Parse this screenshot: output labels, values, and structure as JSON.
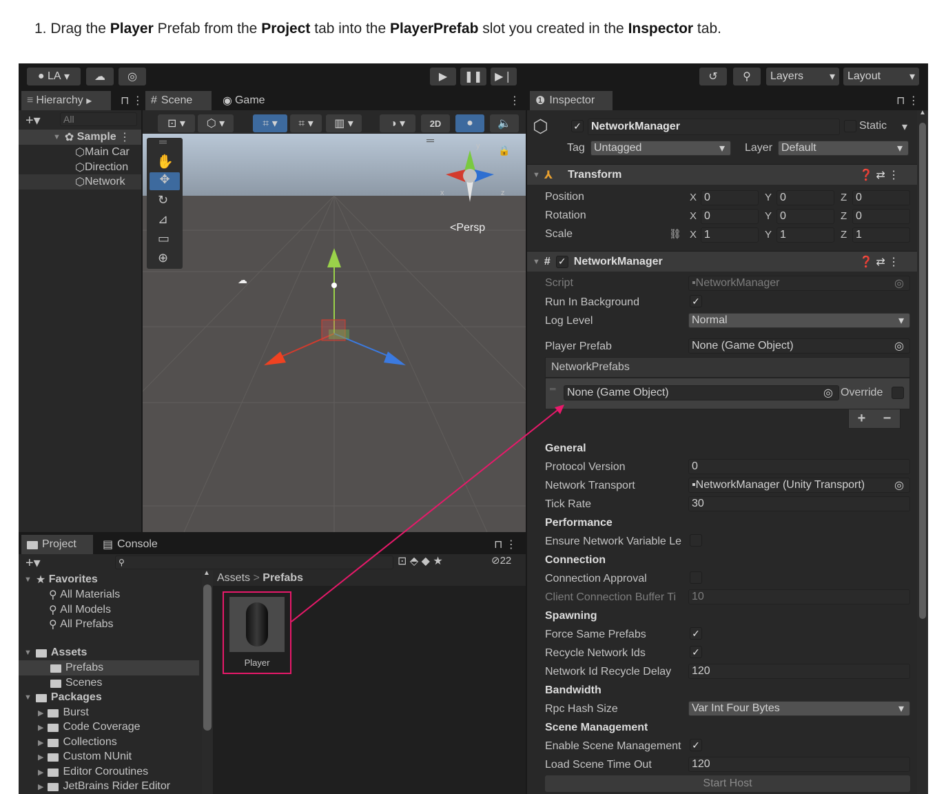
{
  "instruction": {
    "prefix": "1. Drag the ",
    "b1": "Player",
    "t1": " Prefab from the ",
    "b2": "Project",
    "t2": " tab into the ",
    "b3": "PlayerPrefab",
    "t3": " slot you created in the ",
    "b4": "Inspector",
    "t4": " tab."
  },
  "toolbar": {
    "account": "LA",
    "layers": "Layers",
    "layout": "Layout"
  },
  "hierarchy": {
    "tab": "Hierarchy",
    "search_placeholder": "All",
    "scene": "Sample",
    "items": [
      "Main Car",
      "Direction",
      "Network"
    ]
  },
  "scene_tabs": {
    "scene": "Scene",
    "game": "Game",
    "btn_2d": "2D",
    "persp": "Persp",
    "axis_y": "y",
    "axis_x": "x",
    "axis_z": "z"
  },
  "project": {
    "tab_project": "Project",
    "tab_console": "Console",
    "hidden_count": "22",
    "favorites": "Favorites",
    "fav_items": [
      "All Materials",
      "All Models",
      "All Prefabs"
    ],
    "assets": "Assets",
    "asset_items": [
      "Prefabs",
      "Scenes"
    ],
    "packages": "Packages",
    "package_items": [
      "Burst",
      "Code Coverage",
      "Collections",
      "Custom NUnit",
      "Editor Coroutines",
      "JetBrains Rider Editor"
    ],
    "breadcrumb_root": "Assets",
    "breadcrumb_sep": ">",
    "breadcrumb_current": "Prefabs",
    "asset_name": "Player"
  },
  "inspector": {
    "tab": "Inspector",
    "object_name": "NetworkManager",
    "static_label": "Static",
    "tag_label": "Tag",
    "tag_value": "Untagged",
    "layer_label": "Layer",
    "layer_value": "Default",
    "transform": {
      "title": "Transform",
      "position": "Position",
      "rotation": "Rotation",
      "scale": "Scale",
      "pos": [
        "0",
        "0",
        "0"
      ],
      "rot": [
        "0",
        "0",
        "0"
      ],
      "scl": [
        "1",
        "1",
        "1"
      ],
      "x": "X",
      "y": "Y",
      "z": "Z"
    },
    "nm": {
      "title": "NetworkManager",
      "script_label": "Script",
      "script_value": "NetworkManager",
      "run_bg": "Run In Background",
      "log_level": "Log Level",
      "log_value": "Normal",
      "player_prefab": "Player Prefab",
      "player_prefab_value": "None (Game Object)",
      "network_prefabs": "NetworkPrefabs",
      "np_value": "None (Game Object)",
      "override": "Override",
      "plus": "+",
      "minus": "−",
      "general": "General",
      "protocol": "Protocol Version",
      "protocol_value": "0",
      "transport": "Network Transport",
      "transport_value": "NetworkManager (Unity Transport)",
      "tick": "Tick Rate",
      "tick_value": "30",
      "performance": "Performance",
      "ensure": "Ensure Network Variable Le",
      "connection": "Connection",
      "approval": "Connection Approval",
      "buffer": "Client Connection Buffer Ti",
      "buffer_value": "10",
      "spawning": "Spawning",
      "force": "Force Same Prefabs",
      "recycle": "Recycle Network Ids",
      "recycle_delay": "Network Id Recycle Delay",
      "recycle_delay_value": "120",
      "bandwidth": "Bandwidth",
      "rpc": "Rpc Hash Size",
      "rpc_value": "Var Int Four Bytes",
      "scene_mgmt": "Scene Management",
      "enable_scene": "Enable Scene Management",
      "load_timeout": "Load Scene Time Out",
      "load_timeout_value": "120",
      "start_host": "Start Host"
    }
  },
  "colors": {
    "highlight": "#e8196a",
    "editor_bg": "#282828",
    "toolbar_bg": "#191919",
    "accent_blue": "#3d6a9e"
  }
}
